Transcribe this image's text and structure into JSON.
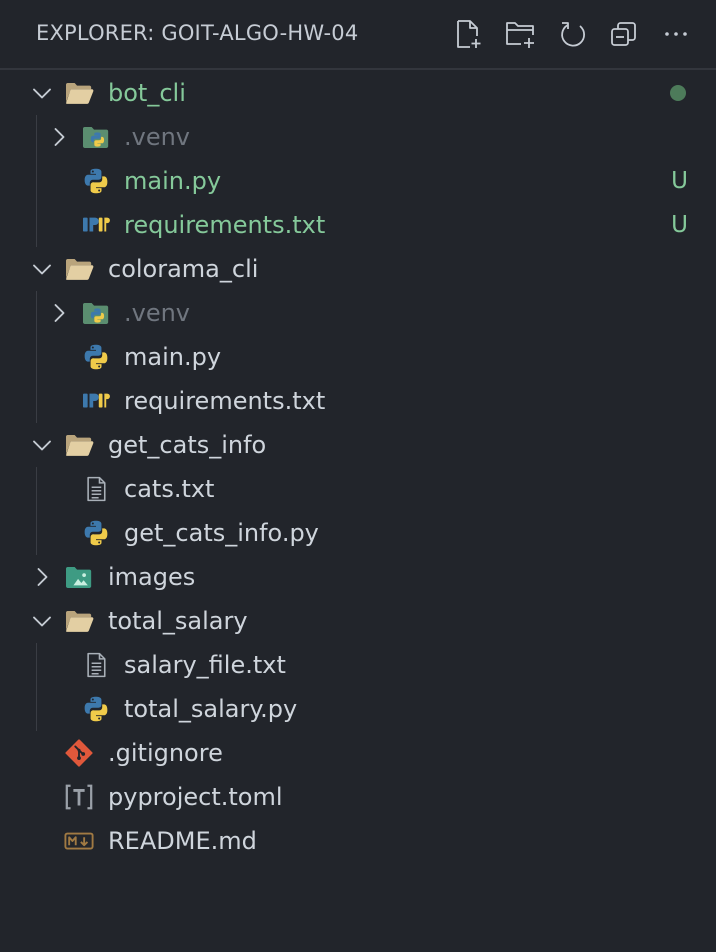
{
  "header": {
    "title": "EXPLORER: GOIT-ALGO-HW-04"
  },
  "toolbar": {
    "new_file_icon": "new-file-icon",
    "new_folder_icon": "new-folder-icon",
    "refresh_icon": "refresh-icon",
    "collapse_icon": "collapse-all-icon",
    "more_icon": "more-actions-icon"
  },
  "colors": {
    "background": "#22252b",
    "git_untracked": "#85c99a",
    "folder": "#d9c49a",
    "dimmed": "#70767f"
  },
  "tree": {
    "bot_cli": {
      "label": "bot_cli"
    },
    "bot_venv": {
      "label": ".venv"
    },
    "bot_main": {
      "label": "main.py",
      "badge": "U"
    },
    "bot_req": {
      "label": "requirements.txt",
      "badge": "U"
    },
    "colorama_cli": {
      "label": "colorama_cli"
    },
    "colorama_venv": {
      "label": ".venv"
    },
    "colorama_main": {
      "label": "main.py"
    },
    "colorama_req": {
      "label": "requirements.txt"
    },
    "get_cats_info": {
      "label": "get_cats_info"
    },
    "cats_txt": {
      "label": "cats.txt"
    },
    "get_cats_py": {
      "label": "get_cats_info.py"
    },
    "images": {
      "label": "images"
    },
    "total_salary": {
      "label": "total_salary"
    },
    "salary_file": {
      "label": "salary_file.txt"
    },
    "total_salary_py": {
      "label": "total_salary.py"
    },
    "gitignore": {
      "label": ".gitignore"
    },
    "pyproject": {
      "label": "pyproject.toml"
    },
    "readme": {
      "label": "README.md"
    }
  }
}
